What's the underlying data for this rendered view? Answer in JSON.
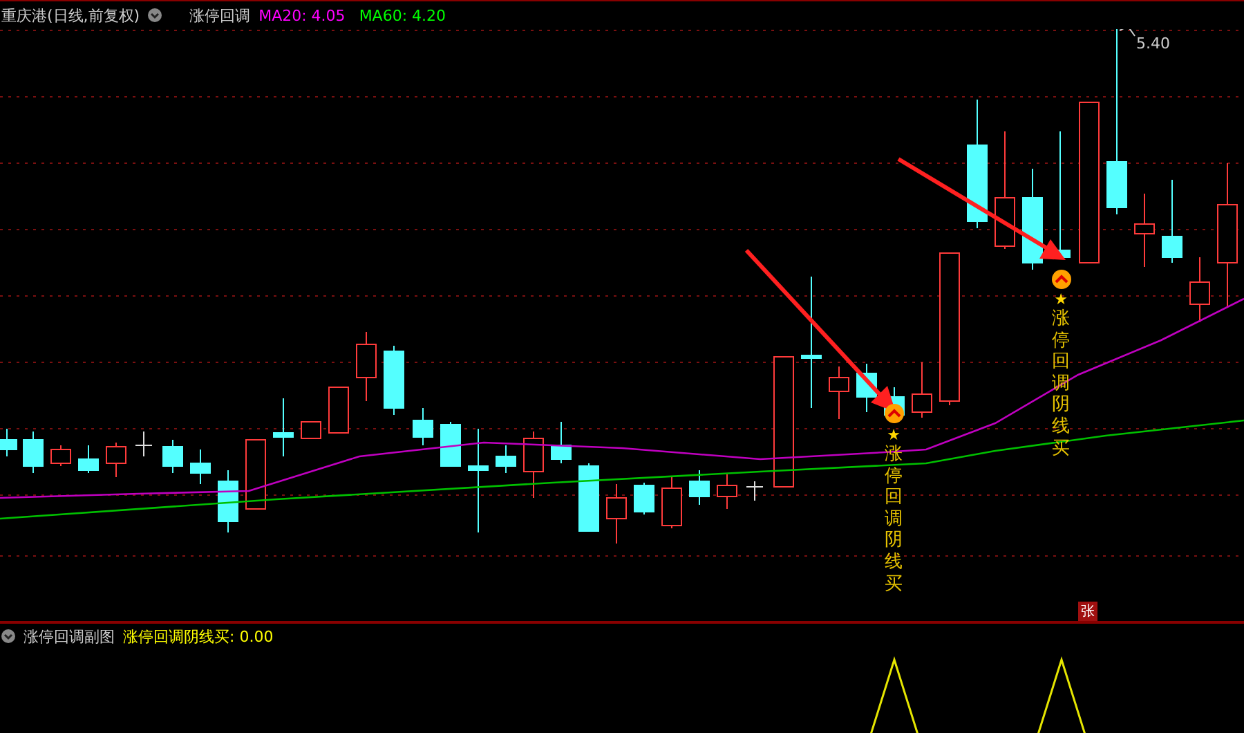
{
  "header": {
    "stock_title": "重庆港(日线,前复权)",
    "indicator_name": "涨停回调",
    "ma": [
      {
        "label": "MA20: 4.05",
        "color": "#ff00ff"
      },
      {
        "label": "MA60: 4.20",
        "color": "#00ff00"
      }
    ]
  },
  "main_chart": {
    "high_label": "5.40",
    "signals": [
      {
        "star": "★",
        "text": "涨停回调阴线买"
      },
      {
        "star": "★",
        "text": "涨停回调阴线买"
      }
    ],
    "badge": "张"
  },
  "sub_chart": {
    "title": "涨停回调副图",
    "reading": "涨停回调阴线买: 0.00"
  }
}
